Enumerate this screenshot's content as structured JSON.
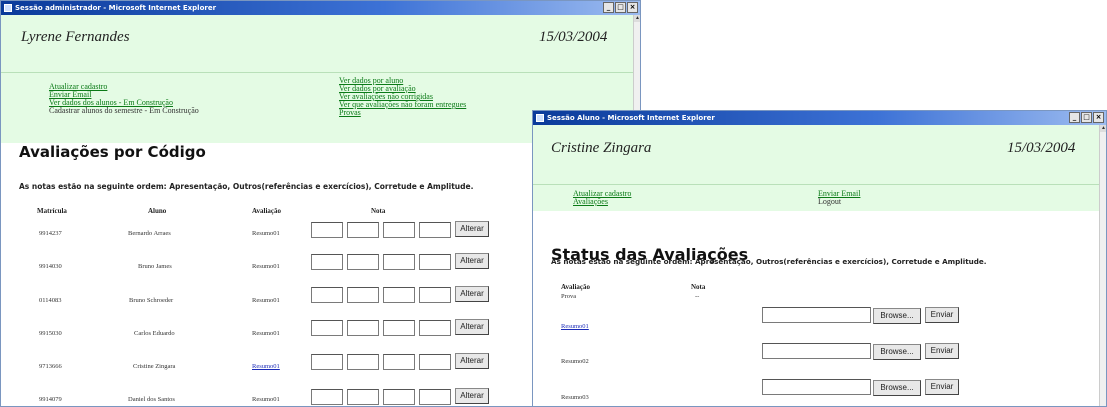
{
  "admin_window": {
    "title": "Sessão administrador - Microsoft Internet Explorer",
    "user_name": "Lyrene Fernandes",
    "date": "15/03/2004",
    "nav_left": [
      "Atualizar cadastro",
      "Enviar Email",
      "Ver dados dos alunos - Em Construção"
    ],
    "nav_left_plain": "Cadastrar alunos do semestre - Em Construção",
    "nav_right": [
      "Ver dados por aluno",
      "Ver dados por avaliação",
      "Ver avaliações não corrigidas",
      "Ver que avaliações não foram entregues",
      "Provas"
    ],
    "heading": "Avaliações por Código",
    "note": "As notas estão na seguinte ordem: Apresentação, Outros(referências e exercícios), Corretude e Amplitude.",
    "table_headers": {
      "matricula": "Matrícula",
      "aluno": "Aluno",
      "avaliacao": "Avaliação",
      "nota": "Nota"
    },
    "button_label": "Alterar",
    "rows": [
      {
        "matricula": "9914237",
        "aluno": "Bernardo Arraes",
        "avaliacao": "Resumo01"
      },
      {
        "matricula": "9914030",
        "aluno": "Bruno James",
        "avaliacao": "Resumo01"
      },
      {
        "matricula": "0114083",
        "aluno": "Bruno Schroeder",
        "avaliacao": "Resumo01"
      },
      {
        "matricula": "9915030",
        "aluno": "Carlos Eduardo",
        "avaliacao": "Resumo01"
      },
      {
        "matricula": "9713666",
        "aluno": "Cristine Zingara",
        "avaliacao": "Resumo01"
      },
      {
        "matricula": "9914079",
        "aluno": "Daniel dos Santos",
        "avaliacao": "Resumo01"
      }
    ]
  },
  "student_window": {
    "title": "Sessão Aluno - Microsoft Internet Explorer",
    "user_name": "Cristine Zingara",
    "date": "15/03/2004",
    "nav_left": [
      "Atualizar cadastro",
      "Avaliações"
    ],
    "nav_right_link": "Enviar Email",
    "nav_right_plain": "Logout",
    "heading": "Status das Avaliações",
    "note": "As notas estão na seguinte ordem: Apresentação, Outros(referências e exercícios), Corretude e Amplitude.",
    "table_headers": {
      "avaliacao": "Avaliação",
      "nota": "Nota"
    },
    "prova_label": "Prova",
    "prova_nota": "--",
    "browse_label": "Browse...",
    "send_label": "Enviar",
    "rows": [
      {
        "avaliacao": "Resumo01"
      },
      {
        "avaliacao": "Resumo02"
      },
      {
        "avaliacao": "Resumo03"
      }
    ]
  }
}
